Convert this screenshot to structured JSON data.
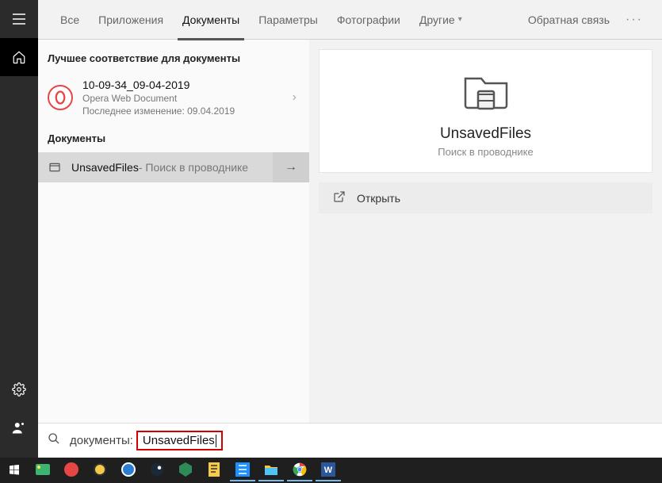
{
  "tabs": {
    "all": "Все",
    "apps": "Приложения",
    "docs": "Документы",
    "settings": "Параметры",
    "photos": "Фотографии",
    "more": "Другие"
  },
  "feedback": "Обратная связь",
  "section_best": "Лучшее соответствие для документы",
  "section_docs": "Документы",
  "results": {
    "best": {
      "title": "10-09-34_09-04-2019",
      "type": "Opera Web Document",
      "modified": "Последнее изменение: 09.04.2019"
    },
    "selected": {
      "title": "UnsavedFiles",
      "suffix": " - Поиск в проводнике"
    }
  },
  "preview": {
    "title": "UnsavedFiles",
    "sub": "Поиск в проводнике",
    "open": "Открыть"
  },
  "search": {
    "prefix": "документы:",
    "term": "UnsavedFiles"
  }
}
